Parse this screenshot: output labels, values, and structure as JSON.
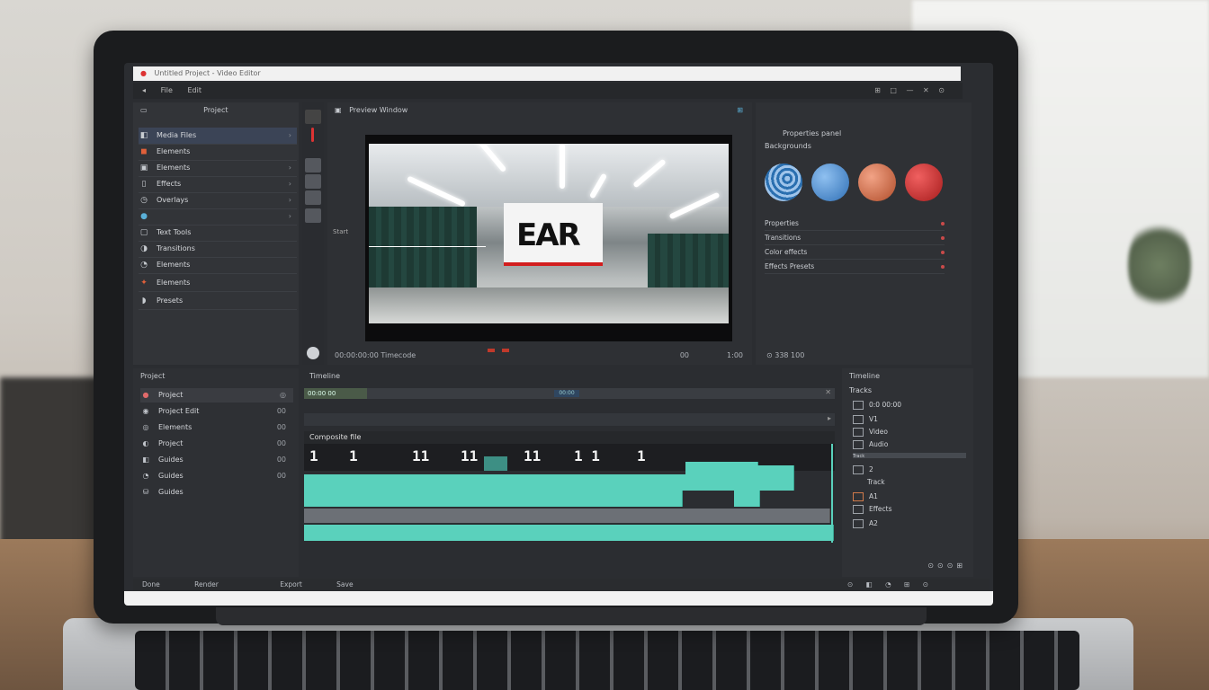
{
  "titlebar": {
    "text": "Untitled Project - Video Editor"
  },
  "menubar": {
    "items": [
      "File",
      "Edit"
    ],
    "right_icons": [
      "⊞",
      "□",
      "—",
      "✕",
      "⊙"
    ]
  },
  "left_panel": {
    "header": "Project",
    "items": [
      {
        "label": "Media Files",
        "icon": "◧",
        "active": true
      },
      {
        "label": "Elements",
        "icon": "◼"
      },
      {
        "label": "Elements",
        "icon": "▣"
      },
      {
        "label": "Effects",
        "icon": "▯"
      },
      {
        "label": "Overlays",
        "icon": "◷"
      },
      {
        "label": "",
        "icon": "●"
      },
      {
        "label": "Text Tools",
        "icon": "▢"
      },
      {
        "label": "Transitions",
        "icon": "◑"
      },
      {
        "label": "Elements",
        "icon": "◔"
      },
      {
        "label": "Elements",
        "icon": "✦"
      },
      {
        "label": "Presets",
        "icon": "◗"
      }
    ]
  },
  "preview": {
    "header": "Preview Window",
    "sign_text": "EAR",
    "left_label": "Start",
    "foot_left": "00:00:00:00 Timecode",
    "foot_right1": "00",
    "foot_right2": "1:00"
  },
  "library": {
    "header": "Properties panel",
    "subheader": "Backgrounds",
    "ball_colors": [
      "#2a6fb0",
      "#4b8fd6",
      "#d9734e",
      "#c8262b"
    ],
    "rows": [
      "Properties",
      "Transitions",
      "Color effects",
      "Effects Presets"
    ],
    "foot": "⊙ 338 100"
  },
  "bottom_left": {
    "header": "Project",
    "items": [
      {
        "label": "Project",
        "icon": "●",
        "value": "◎",
        "active": true
      },
      {
        "label": "Project Edit",
        "icon": "◉",
        "value": "00"
      },
      {
        "label": "Elements",
        "icon": "◎",
        "value": "00"
      },
      {
        "label": "Project",
        "icon": "◐",
        "value": "00"
      },
      {
        "label": "Guides",
        "icon": "◧",
        "value": "00"
      },
      {
        "label": "Guides",
        "icon": "◔",
        "value": "00"
      },
      {
        "label": "Guides",
        "icon": "⛁",
        "value": ""
      }
    ]
  },
  "timeline": {
    "header": "Timeline",
    "ruler_label": "00:00 00",
    "cursor_label": "00:00",
    "track_label": "Composite file",
    "numbers": [
      "1",
      "1",
      "11",
      "11",
      "11",
      "1 1",
      "1"
    ]
  },
  "right_bottom": {
    "header": "Timeline",
    "subheader": "Tracks",
    "rows": [
      {
        "label": "0:0 00:00"
      },
      {
        "label": "V1"
      },
      {
        "label": "Video"
      },
      {
        "label": "Audio"
      },
      {
        "label": "Track",
        "selected": true
      },
      {
        "label": "2"
      },
      {
        "label": "Track"
      },
      {
        "label": "A1"
      },
      {
        "label": "Effects"
      },
      {
        "label": "A2"
      }
    ],
    "foot": "⊙⊙⊙⊞"
  },
  "statusbar": {
    "items": [
      "Done",
      "Render",
      "Export",
      "Save"
    ],
    "icons": "⊙ ◧ ◔ ⊞ ⊙"
  }
}
